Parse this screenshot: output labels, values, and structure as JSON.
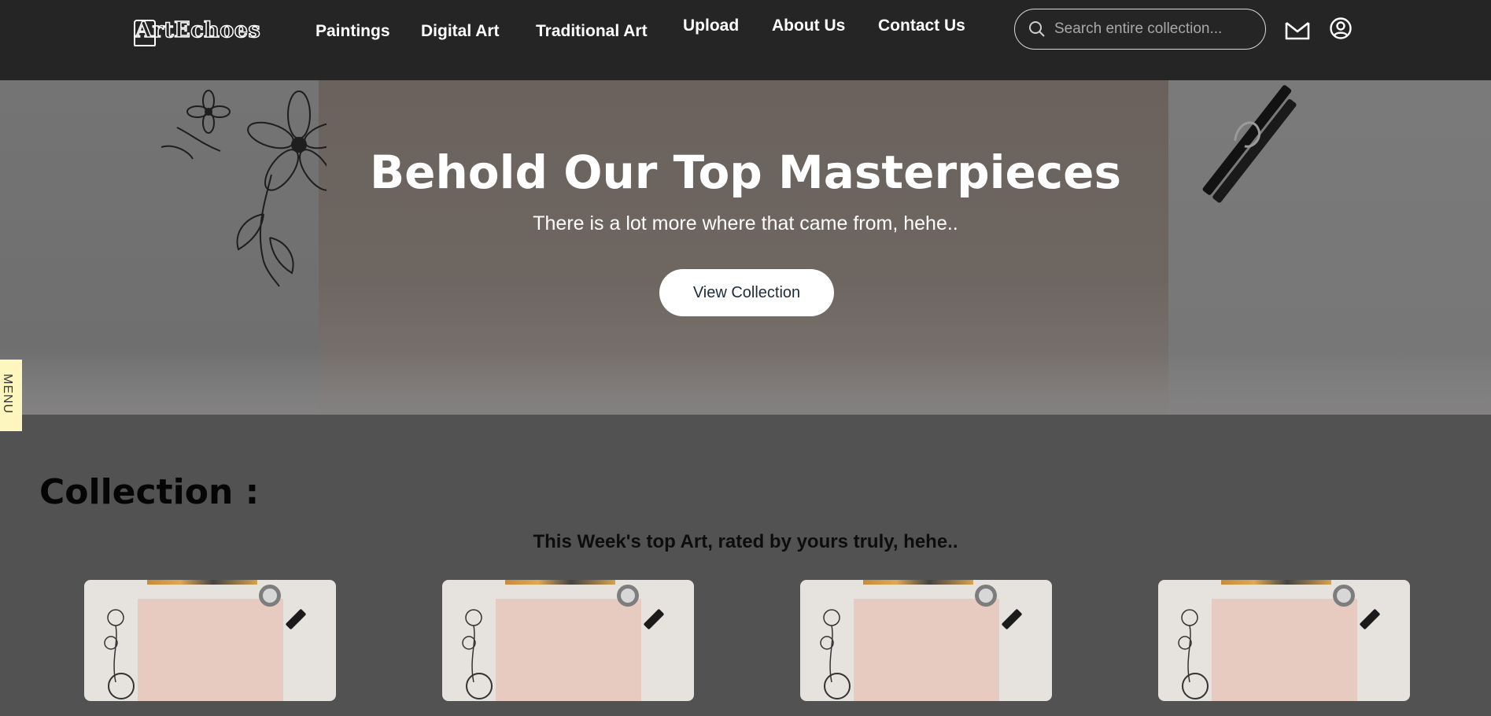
{
  "nav": {
    "logo": "ArtEchoes",
    "links": [
      "Paintings",
      "Digital Art",
      "Traditional Art",
      "Upload",
      "About Us",
      "Contact Us"
    ],
    "search_placeholder": "Search entire collection..."
  },
  "icons": {
    "search": "search-icon",
    "mail": "mail-icon",
    "account": "user-circle-icon"
  },
  "hero": {
    "title": "Behold Our Top Masterpieces",
    "subtitle": "There is a lot more where that came from, hehe..",
    "button": "View Collection"
  },
  "side_menu": {
    "label": "MENU"
  },
  "collection": {
    "title": "Collection :",
    "subtitle": "This Week's top Art, rated by yours truly, hehe..",
    "cards": [
      {
        "id": 1
      },
      {
        "id": 2
      },
      {
        "id": 3
      },
      {
        "id": 4
      }
    ]
  },
  "colors": {
    "navbar": "#252525",
    "page_bg": "#525252",
    "menu_tab": "#fdf7bf",
    "text_light": "#ffffff"
  }
}
